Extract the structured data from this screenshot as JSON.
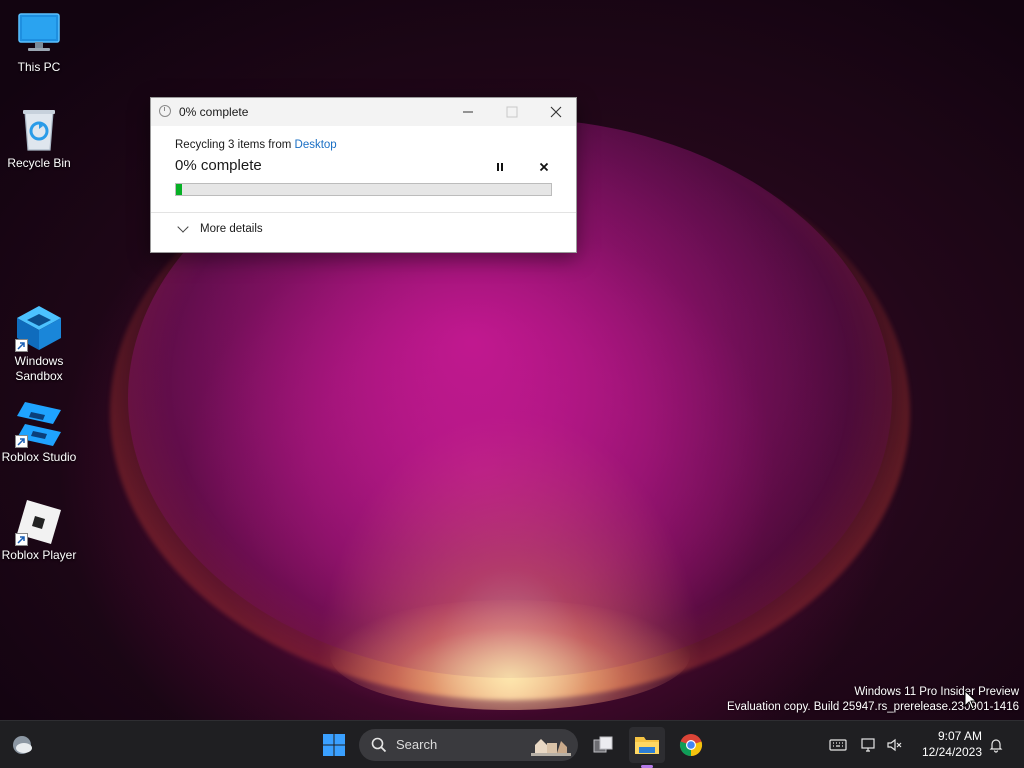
{
  "desktop": {
    "icons": [
      {
        "label": "This PC"
      },
      {
        "label": "Recycle Bin"
      },
      {
        "label": "Windows Sandbox"
      },
      {
        "label": "Roblox Studio"
      },
      {
        "label": "Roblox Player"
      }
    ],
    "watermark": {
      "line1": "Windows 11 Pro Insider Preview",
      "line2": "Evaluation copy. Build 25947.rs_prerelease.230901-1416"
    }
  },
  "dialog": {
    "title": "0% complete",
    "operation_prefix": "Recycling 3 items from ",
    "operation_location": "Desktop",
    "percent_text": "0% complete",
    "progress": 0.015,
    "more_details_label": "More details",
    "colors": {
      "progress": "#06b025",
      "link": "#1a6fc4"
    }
  },
  "taskbar": {
    "search_label": "Search",
    "clock": {
      "time": "9:07 AM",
      "date": "12/24/2023"
    }
  }
}
